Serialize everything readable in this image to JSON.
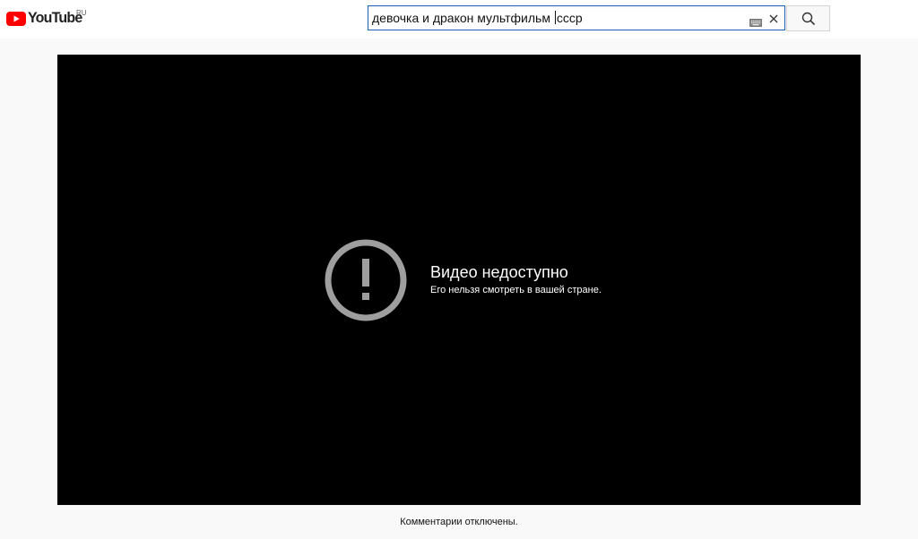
{
  "header": {
    "logo_text": "YouTube",
    "logo_country": "RU",
    "search": {
      "value_before_caret": "девочка и дракон мультфильм ",
      "value_after_caret": "ссср"
    }
  },
  "player": {
    "error_title": "Видео недоступно",
    "error_subtitle": "Его нельзя смотреть в вашей стране."
  },
  "comments": {
    "status": "Комментарии отключены."
  },
  "colors": {
    "brand_red": "#ff0000",
    "search_border": "#1c62b9",
    "player_bg": "#000000",
    "page_bg": "#f9f9f9"
  },
  "icons": [
    "youtube-logo-icon",
    "keyboard-icon",
    "clear-icon",
    "search-icon",
    "alert-circle-icon"
  ]
}
